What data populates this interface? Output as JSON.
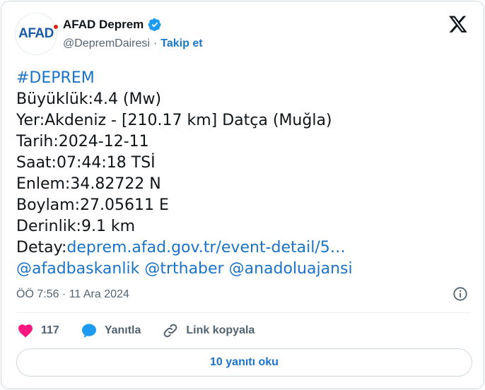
{
  "author": {
    "display_name": "AFAD Deprem",
    "handle": "@DepremDairesi",
    "separator": "·",
    "follow_label": "Takip et",
    "avatar_text": "AFAD"
  },
  "tweet": {
    "hashtag": "#DEPREM",
    "lines": {
      "magnitude": "Büyüklük:4.4 (Mw)",
      "location": "Yer:Akdeniz - [210.17 km] Datça (Muğla)",
      "date": "Tarih:2024-12-11",
      "time": "Saat:07:44:18 TSİ",
      "latitude": "Enlem:34.82722 N",
      "longitude": "Boylam:27.05611 E",
      "depth": "Derinlik:9.1 km"
    },
    "detail_prefix": "Detay:",
    "detail_link": "deprem.afad.gov.tr/event-detail/5…",
    "mentions": [
      "@afadbaskanlik",
      "@trthaber",
      "@anadoluajansi"
    ]
  },
  "meta": {
    "timestamp": "ÖÖ 7:56 · 11 Ara 2024"
  },
  "actions": {
    "likes_count": "117",
    "reply_label": "Yanıtla",
    "copy_link_label": "Link kopyala"
  },
  "read_replies_label": "10 yanıtı oku",
  "colors": {
    "accent": "#1a73c8",
    "verified": "#1d9bf0",
    "like": "#f91880",
    "muted": "#536471"
  }
}
